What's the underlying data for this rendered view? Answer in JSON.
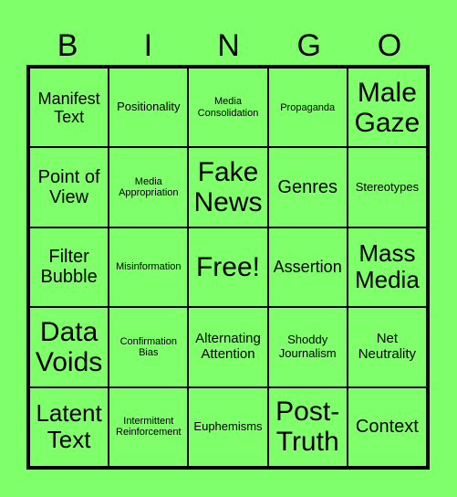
{
  "header": [
    "B",
    "I",
    "N",
    "G",
    "O"
  ],
  "cells": [
    {
      "text": "Manifest Text",
      "size": "s4"
    },
    {
      "text": "Positionality",
      "size": "s2"
    },
    {
      "text": "Media Consolidation",
      "size": "s1"
    },
    {
      "text": "Propaganda",
      "size": "s1"
    },
    {
      "text": "Male Gaze",
      "size": "s7"
    },
    {
      "text": "Point of View",
      "size": "s5"
    },
    {
      "text": "Media Appropriation",
      "size": "s1"
    },
    {
      "text": "Fake News",
      "size": "s7"
    },
    {
      "text": "Genres",
      "size": "s5"
    },
    {
      "text": "Stereotypes",
      "size": "s2"
    },
    {
      "text": "Filter Bubble",
      "size": "s5"
    },
    {
      "text": "Misinformation",
      "size": "s1"
    },
    {
      "text": "Free!",
      "size": "s7"
    },
    {
      "text": "Assertion",
      "size": "s4"
    },
    {
      "text": "Mass Media",
      "size": "s6"
    },
    {
      "text": "Data Voids",
      "size": "s7"
    },
    {
      "text": "Confirmation Bias",
      "size": "s1"
    },
    {
      "text": "Alternating Attention",
      "size": "s3"
    },
    {
      "text": "Shoddy Journalism",
      "size": "s2"
    },
    {
      "text": "Net Neutrality",
      "size": "s3"
    },
    {
      "text": "Latent Text",
      "size": "s6"
    },
    {
      "text": "Intermittent Reinforcement",
      "size": "s1"
    },
    {
      "text": "Euphemisms",
      "size": "s2"
    },
    {
      "text": "Post-Truth",
      "size": "s7"
    },
    {
      "text": "Context",
      "size": "s5"
    }
  ]
}
